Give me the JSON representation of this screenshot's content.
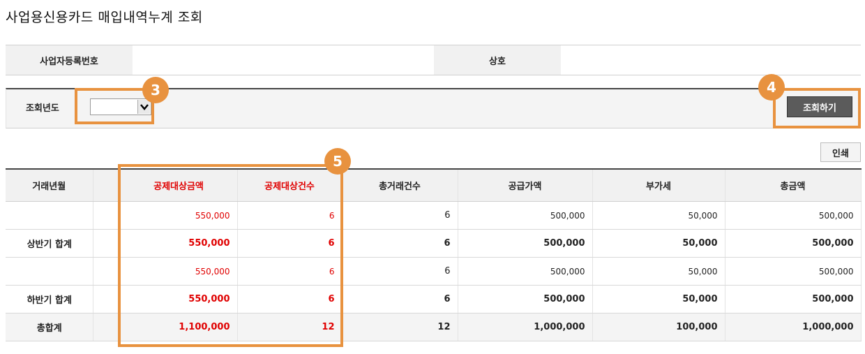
{
  "page": {
    "title": "사업용신용카드 매입내역누계 조회"
  },
  "info": {
    "reg_no_label": "사업자등록번호",
    "reg_no_value": "",
    "company_label": "상호",
    "company_value": ""
  },
  "search": {
    "year_label": "조회년도",
    "year_value": "",
    "button_label": "조회하기"
  },
  "toolbar": {
    "print_label": "인쇄"
  },
  "table": {
    "headers": [
      "거래년월",
      "",
      "공제대상금액",
      "공제대상건수",
      "총거래건수",
      "공급가액",
      "부가세",
      "총금액"
    ],
    "rows": [
      {
        "month": "",
        "blank": "",
        "deduct_amount": "550,000",
        "deduct_count": "6",
        "total_count": "6",
        "supply": "500,000",
        "vat": "50,000",
        "total": "500,000"
      },
      {
        "month": "상반기 합계",
        "blank": "",
        "deduct_amount": "550,000",
        "deduct_count": "6",
        "total_count": "6",
        "supply": "500,000",
        "vat": "50,000",
        "total": "500,000"
      },
      {
        "month": "",
        "blank": "",
        "deduct_amount": "550,000",
        "deduct_count": "6",
        "total_count": "6",
        "supply": "500,000",
        "vat": "50,000",
        "total": "500,000"
      },
      {
        "month": "하반기 합계",
        "blank": "",
        "deduct_amount": "550,000",
        "deduct_count": "6",
        "total_count": "6",
        "supply": "500,000",
        "vat": "50,000",
        "total": "500,000"
      },
      {
        "month": "총합계",
        "blank": "",
        "deduct_amount": "1,100,000",
        "deduct_count": "12",
        "total_count": "12",
        "supply": "1,000,000",
        "vat": "100,000",
        "total": "1,000,000"
      }
    ]
  },
  "callouts": [
    "3",
    "4",
    "5"
  ],
  "colors": {
    "accent": "#e8923f",
    "highlight_text": "#e00000",
    "button_bg": "#5b5b5b"
  }
}
